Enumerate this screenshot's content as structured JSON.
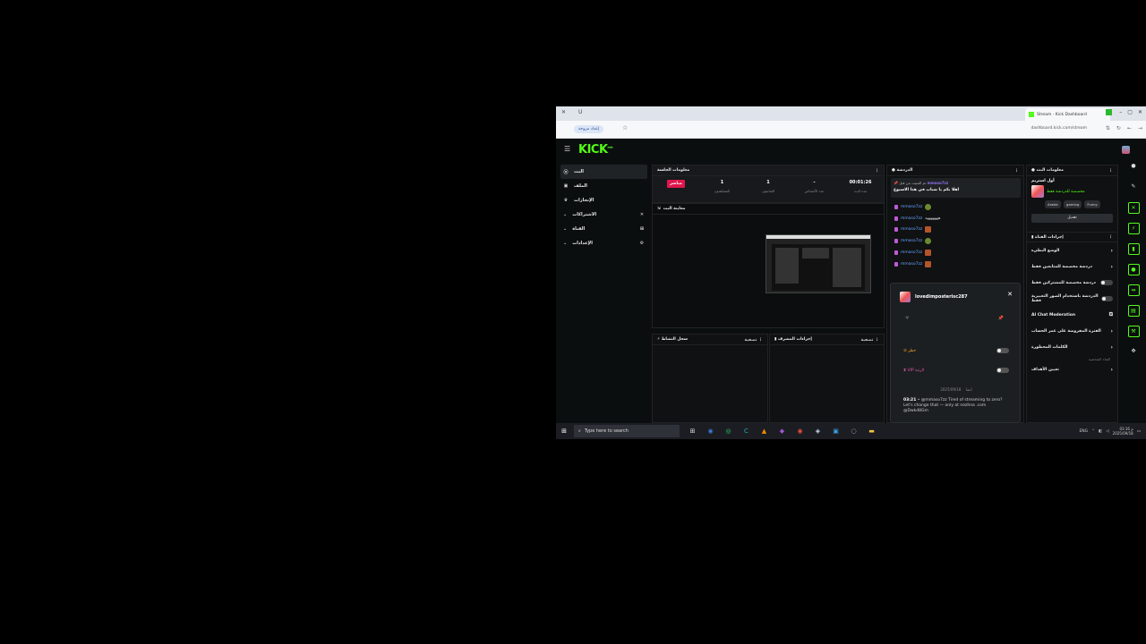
{
  "browser": {
    "tab_title": "Stream - Kick Dashboard",
    "new_tab_glyph": "+",
    "window_controls": [
      "–",
      "▢",
      "✕"
    ],
    "bookmark_pill": "إعداد مروحة",
    "url": "dashboard.kick.com/stream",
    "tab_left_glyphs": [
      "✕",
      "U"
    ]
  },
  "app": {
    "logo": "KICK",
    "logo_sup": "beta",
    "sidebar": [
      {
        "label": "البث",
        "icon": "broadcast-icon",
        "glyph": "((•))",
        "active": true,
        "chev": false
      },
      {
        "label": "الملف",
        "icon": "profile-icon",
        "glyph": "▣",
        "active": false,
        "chev": false
      },
      {
        "label": "الإنجازات",
        "icon": "trophy-icon",
        "glyph": "🏆",
        "active": false,
        "chev": false
      },
      {
        "label": "الاشتراكات",
        "icon": "tools-icon",
        "glyph": "✕",
        "active": false,
        "chev": true
      },
      {
        "label": "القناة",
        "icon": "channel-icon",
        "glyph": "⊞",
        "active": false,
        "chev": true
      },
      {
        "label": "الإعدادات",
        "icon": "settings-icon",
        "glyph": "⚙",
        "active": false,
        "chev": true
      }
    ],
    "session": {
      "title": "معلومات الجلسة",
      "live_badge": "مباشر",
      "stats": [
        {
          "value": "1",
          "label": "المشاهدون"
        },
        {
          "value": "1",
          "label": "المتابعون"
        },
        {
          "value": "-",
          "label": "عدد الأشخاص"
        },
        {
          "value": "00:01:26",
          "label": "مدة البث"
        }
      ]
    },
    "preview": {
      "title": "معاينة البث"
    },
    "activity": {
      "title": "سجل النشاط",
      "filter": "تصفية"
    },
    "mod_actions": {
      "title": "إجراءات المشرف",
      "filter": "تصفية"
    },
    "chat": {
      "title": "الدردشة",
      "pinned_by": "تم التثبيت من قبل",
      "pinned_user": "mmaso7zz",
      "pinned_msg": "اهلا بكم يا شباب في هذا الاسبوع",
      "lines": [
        {
          "user": "mmaso7zz",
          "text": "",
          "emo": "round"
        },
        {
          "user": "mmaso7zz",
          "text": "هههههههه",
          "emo": "none"
        },
        {
          "user": "mmaso7zz",
          "text": "",
          "emo": "square"
        },
        {
          "user": "mmaso7zz",
          "text": "",
          "emo": "round"
        },
        {
          "user": "mmaso7zz",
          "text": "",
          "emo": "square"
        },
        {
          "user": "mmaso7zz",
          "text": "",
          "emo": "square"
        }
      ]
    },
    "usercard": {
      "username": "lovedimposterisc287",
      "close": "✕",
      "heart": "♥",
      "pin": "📌",
      "rows": [
        {
          "label": "حظر",
          "icon": "ban-icon"
        },
        {
          "label": "VIP الرتبة",
          "icon": "vip-icon"
        }
      ],
      "date": "2025/09/18",
      "since": "أنشأ",
      "msg_time": "03:21",
      "msg_text": "@mmaso7zz Tired of streaming to zero? Let's change that — only at nezhna .com @Dwkd8Gm"
    },
    "info": {
      "title": "معلومات البث",
      "stream_title": "أول استريم",
      "category": "مخصصة للدردشة فقط",
      "tags": [
        "Arabic",
        "gaming",
        "Funny"
      ],
      "edit_label": "تعديل",
      "quick_actions_title": "إجراءات القناة",
      "actions": [
        {
          "label": "الوضع البطيء",
          "kind": "chev"
        },
        {
          "label": "دردشة مخصصة للمتابعين فقط",
          "kind": "chev"
        },
        {
          "label": "دردشة مخصصة للمشتركين فقط",
          "kind": "toggle"
        },
        {
          "label": "الدردشة باستخدام الصور التعبيرية فقط",
          "kind": "toggle"
        },
        {
          "label": "AI Chat Moderation",
          "kind": "ext"
        },
        {
          "label": "الفترة المفروضة على عمر الحساب",
          "kind": "chev"
        },
        {
          "label": "الكلمات المحظورة",
          "kind": "chev"
        }
      ],
      "note": "القناة الشخصية",
      "goals_label": "تعيين الأهداف"
    },
    "rail": [
      "✕",
      "⚡",
      "▮",
      "●",
      "⇹",
      "▤",
      "⚒",
      "✥"
    ]
  },
  "taskbar": {
    "search_placeholder": "Type here to search",
    "icons": [
      "⊞",
      "◉",
      "◎",
      "C",
      "▲",
      "◆",
      "◉",
      "◈",
      "▣",
      "◌",
      "▬"
    ],
    "tray_lang": "ENG",
    "time": "03:16 م",
    "date": "2025/09/18"
  },
  "colors": {
    "kick_green": "#53fc18",
    "live_red": "#e0164c",
    "username_blue": "#6aa3ff"
  }
}
